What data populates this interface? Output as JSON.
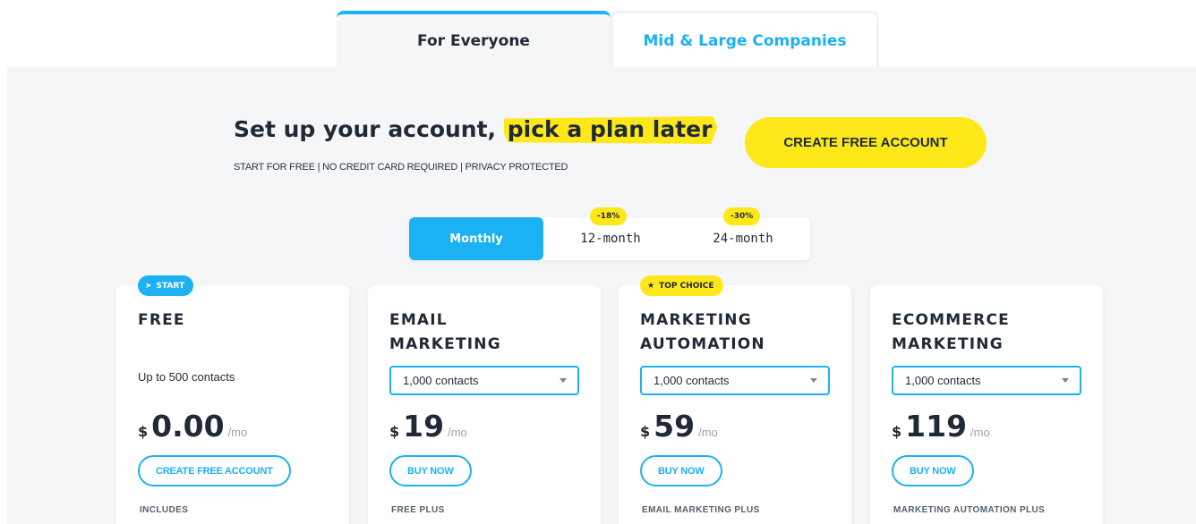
{
  "tabs": [
    {
      "label": "For Everyone",
      "active": true
    },
    {
      "label": "Mid & Large Companies",
      "active": false
    }
  ],
  "hero": {
    "headline_part1": "Set up your account, ",
    "headline_highlight": "pick a plan later",
    "subline": "START FOR FREE | NO CREDIT CARD REQUIRED | PRIVACY PROTECTED",
    "cta_label": "CREATE FREE ACCOUNT"
  },
  "billing": {
    "options": [
      {
        "label": "Monthly",
        "selected": true
      },
      {
        "label": "12-month",
        "discount": "-18%"
      },
      {
        "label": "24-month",
        "discount": "-30%"
      }
    ]
  },
  "plans": [
    {
      "badge": "START",
      "badge_icon": "rocket-icon",
      "title_line1": "FREE",
      "title_line2": "",
      "contacts": "Up to 500 contacts",
      "currency": "$",
      "amount": "0.00",
      "period": "/mo",
      "button": "CREATE FREE ACCOUNT",
      "includes": "INCLUDES"
    },
    {
      "title_line1": "EMAIL",
      "title_line2": "MARKETING",
      "contacts": "1,000 contacts",
      "currency": "$",
      "amount": "19",
      "period": "/mo",
      "button": "BUY NOW",
      "includes": "FREE PLUS"
    },
    {
      "badge": "TOP CHOICE",
      "badge_icon": "star-icon",
      "title_line1": "MARKETING",
      "title_line2": "AUTOMATION",
      "contacts": "1,000 contacts",
      "currency": "$",
      "amount": "59",
      "period": "/mo",
      "button": "BUY NOW",
      "includes": "EMAIL MARKETING PLUS"
    },
    {
      "title_line1": "ECOMMERCE",
      "title_line2": "MARKETING",
      "contacts": "1,000 contacts",
      "currency": "$",
      "amount": "119",
      "period": "/mo",
      "button": "BUY NOW",
      "includes": "MARKETING AUTOMATION PLUS"
    }
  ],
  "colors": {
    "accent_blue": "#1bb1f3",
    "accent_yellow": "#ffe81a",
    "panel_bg": "#f4f6f8",
    "text_dark": "#1f2a36"
  }
}
